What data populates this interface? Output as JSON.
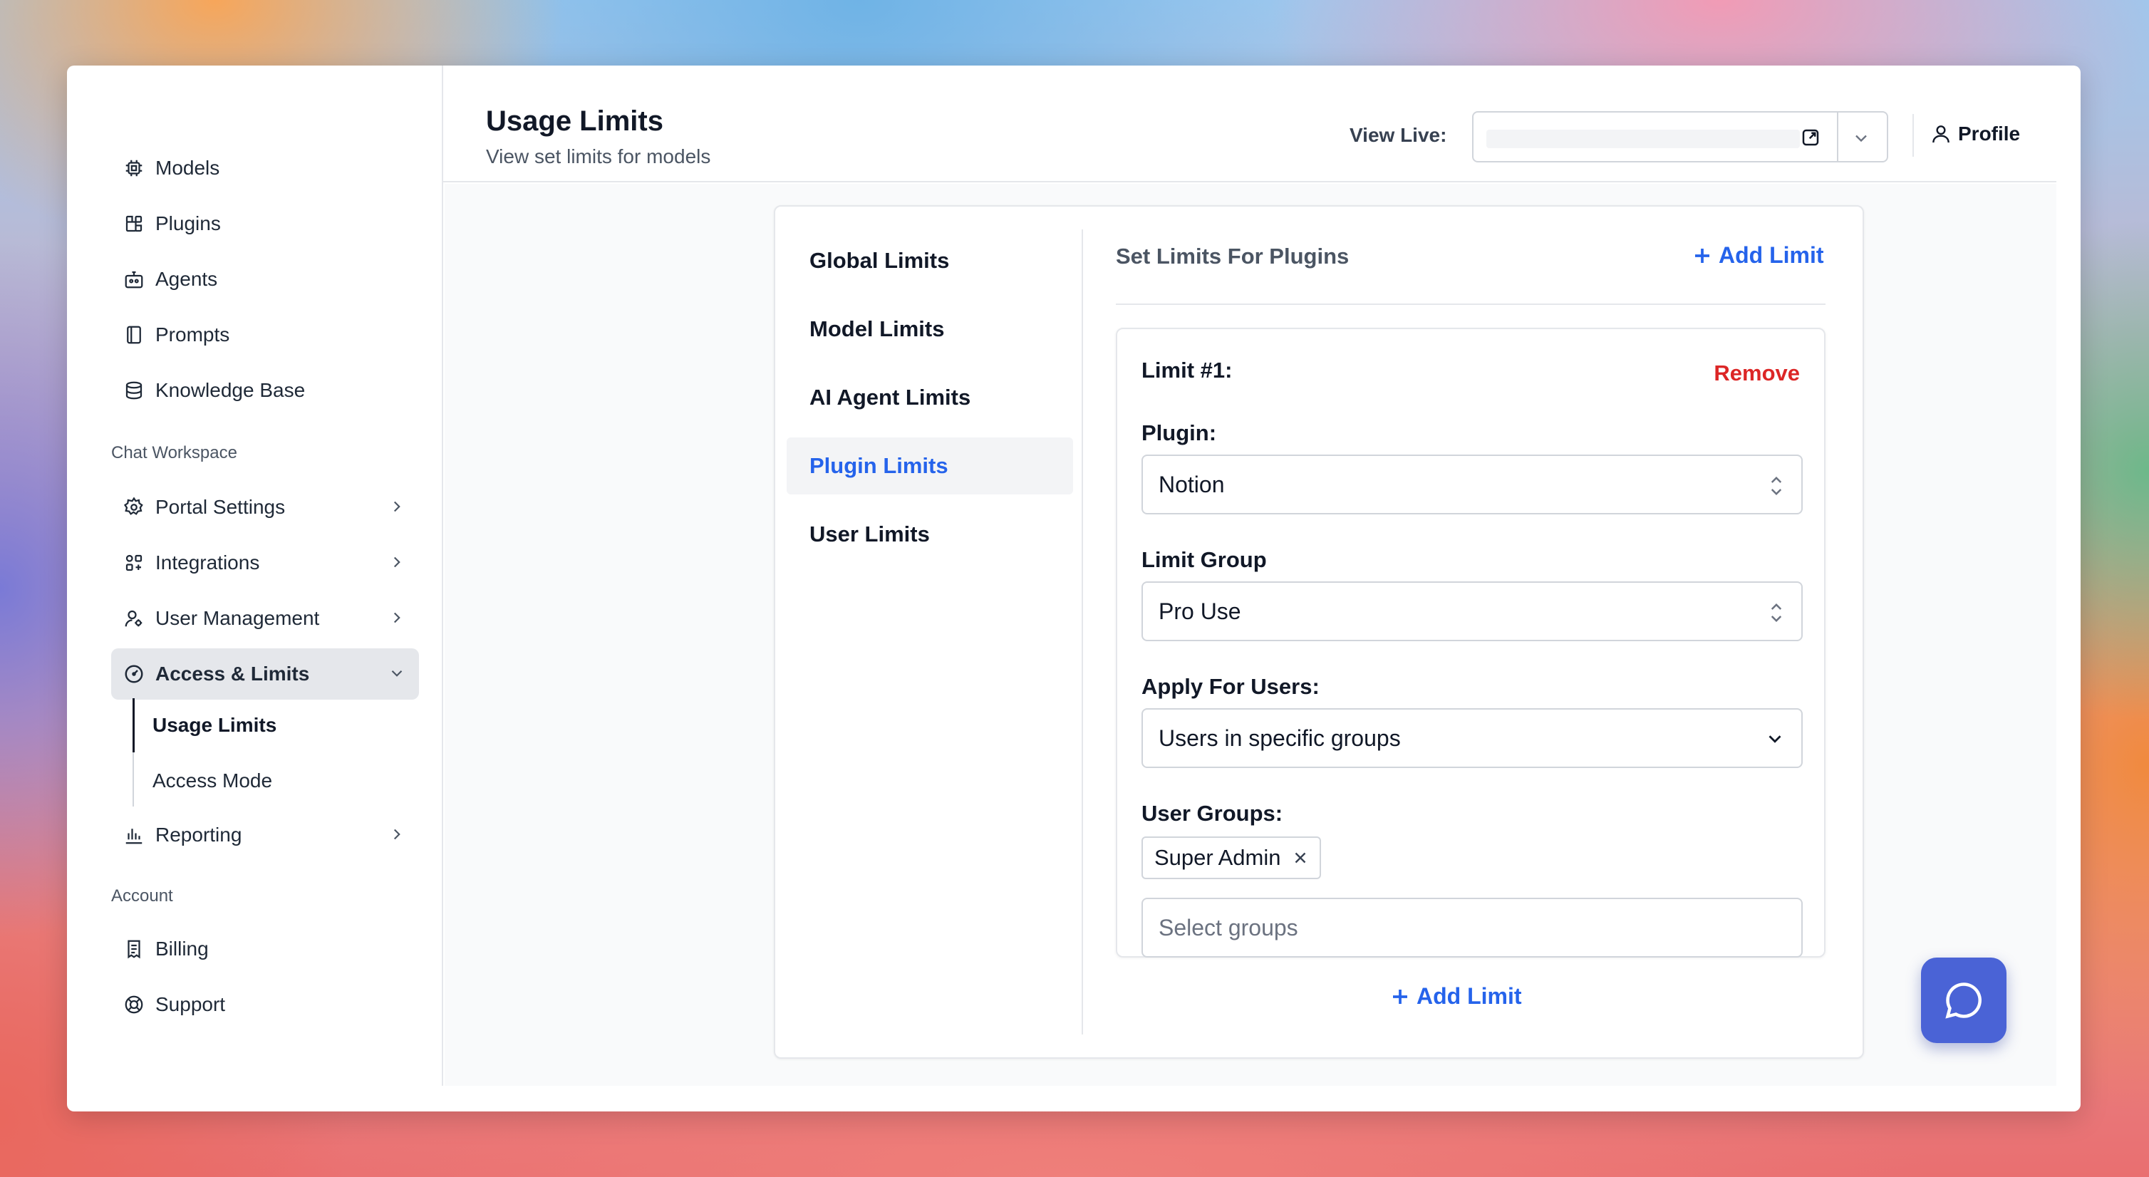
{
  "sidebar": {
    "top_items": [
      {
        "label": "Models",
        "icon": "chip-icon"
      },
      {
        "label": "Plugins",
        "icon": "puzzle-icon"
      },
      {
        "label": "Agents",
        "icon": "agent-icon"
      },
      {
        "label": "Prompts",
        "icon": "notebook-icon"
      },
      {
        "label": "Knowledge Base",
        "icon": "database-icon"
      }
    ],
    "chat_workspace_label": "Chat Workspace",
    "workspace_items": [
      {
        "label": "Portal Settings",
        "icon": "gear-icon"
      },
      {
        "label": "Integrations",
        "icon": "integrations-icon"
      },
      {
        "label": "User Management",
        "icon": "users-gear-icon"
      },
      {
        "label": "Access & Limits",
        "icon": "gauge-icon",
        "expanded": true
      }
    ],
    "access_sub_items": [
      {
        "label": "Usage Limits",
        "active": true
      },
      {
        "label": "Access Mode",
        "active": false
      }
    ],
    "reporting": {
      "label": "Reporting",
      "icon": "bar-chart-icon"
    },
    "account_label": "Account",
    "account_items": [
      {
        "label": "Billing",
        "icon": "receipt-icon"
      },
      {
        "label": "Support",
        "icon": "lifebuoy-icon"
      }
    ]
  },
  "header": {
    "title": "Usage Limits",
    "subtitle": "View set limits for models",
    "view_live_label": "View Live:",
    "profile_label": "Profile"
  },
  "tabs": [
    {
      "label": "Global Limits",
      "active": false
    },
    {
      "label": "Model Limits",
      "active": false
    },
    {
      "label": "AI Agent Limits",
      "active": false
    },
    {
      "label": "Plugin Limits",
      "active": true
    },
    {
      "label": "User Limits",
      "active": false
    }
  ],
  "panel": {
    "title": "Set Limits For Plugins",
    "add_limit_label": "Add Limit",
    "limit": {
      "label": "Limit #1:",
      "remove_label": "Remove",
      "plugin_label": "Plugin:",
      "plugin_value": "Notion",
      "limit_group_label": "Limit Group",
      "limit_group_value": "Pro Use",
      "apply_label": "Apply For Users:",
      "apply_value": "Users in specific groups",
      "user_groups_label": "User Groups:",
      "selected_groups": [
        "Super Admin"
      ],
      "groups_placeholder": "Select groups"
    }
  },
  "colors": {
    "accent": "#2563eb",
    "danger": "#dc2626",
    "fab": "#4a63d6"
  }
}
